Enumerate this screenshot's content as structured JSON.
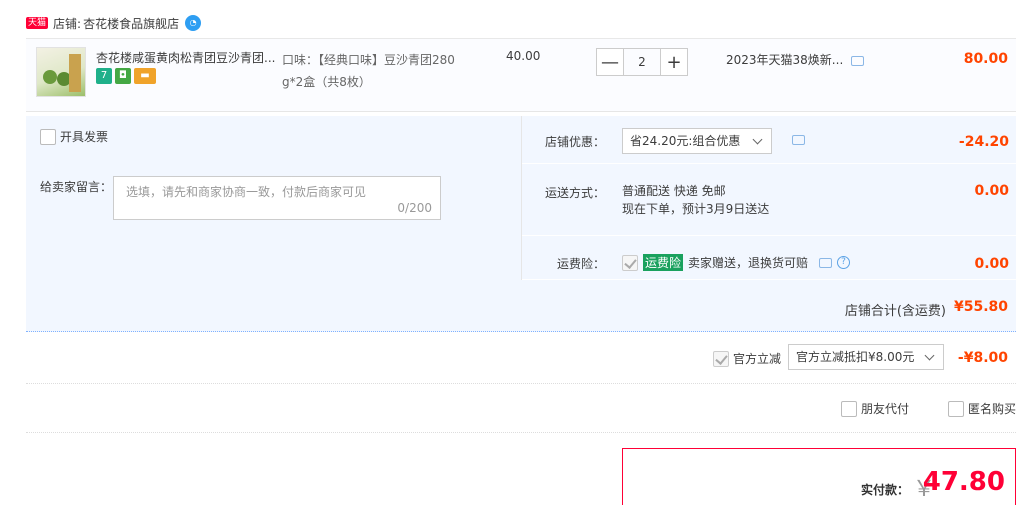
{
  "shop": {
    "badge": "天猫",
    "label": "店铺:",
    "name": "杏花楼食品旗舰店"
  },
  "item": {
    "title": "杏花楼咸蛋黄肉松青团豆沙青团...",
    "sku_line1": "口味：【经典口味】豆沙青团280",
    "sku_line2": "g*2盒（共8枚）",
    "price": "40.00",
    "qty": "2",
    "qty_minus": "—",
    "qty_plus": "+",
    "promo": "2023年天猫38焕新...",
    "subtotal": "80.00",
    "service_icons": [
      "seven-day-return-icon",
      "guarantee-icon",
      "card-icon"
    ]
  },
  "invoice": {
    "label": "开具发票"
  },
  "memo": {
    "label": "给卖家留言：",
    "placeholder": "选填，请先和商家协商一致，付款后商家可见",
    "count": "0/200"
  },
  "shop_discount": {
    "label": "店铺优惠：",
    "selected": "省24.20元:组合优惠",
    "amount": "-24.20"
  },
  "shipping": {
    "label": "运送方式：",
    "line1": "普通配送 快递 免邮",
    "line2": "现在下单，预计3月9日送达",
    "amount": "0.00"
  },
  "insurance": {
    "label": "运费险：",
    "tag": "运费险",
    "text": "卖家赠送，退换货可赔",
    "amount": "0.00"
  },
  "shop_total": {
    "label": "店铺合计(含运费)",
    "amount": "¥55.80"
  },
  "official_discount": {
    "label": "官方立减",
    "selected": "官方立减抵扣¥8.00元",
    "amount": "-¥8.00"
  },
  "extras": {
    "friend_pay": "朋友代付",
    "anonymous": "匿名购买"
  },
  "payment": {
    "label": "实付款：",
    "currency": "￥",
    "amount": "47.80"
  },
  "colors": {
    "accent": "#ff4400",
    "tmall_red": "#ff0036",
    "panel_bg": "#f2f7ff",
    "insurance_green": "#1aa15e"
  }
}
